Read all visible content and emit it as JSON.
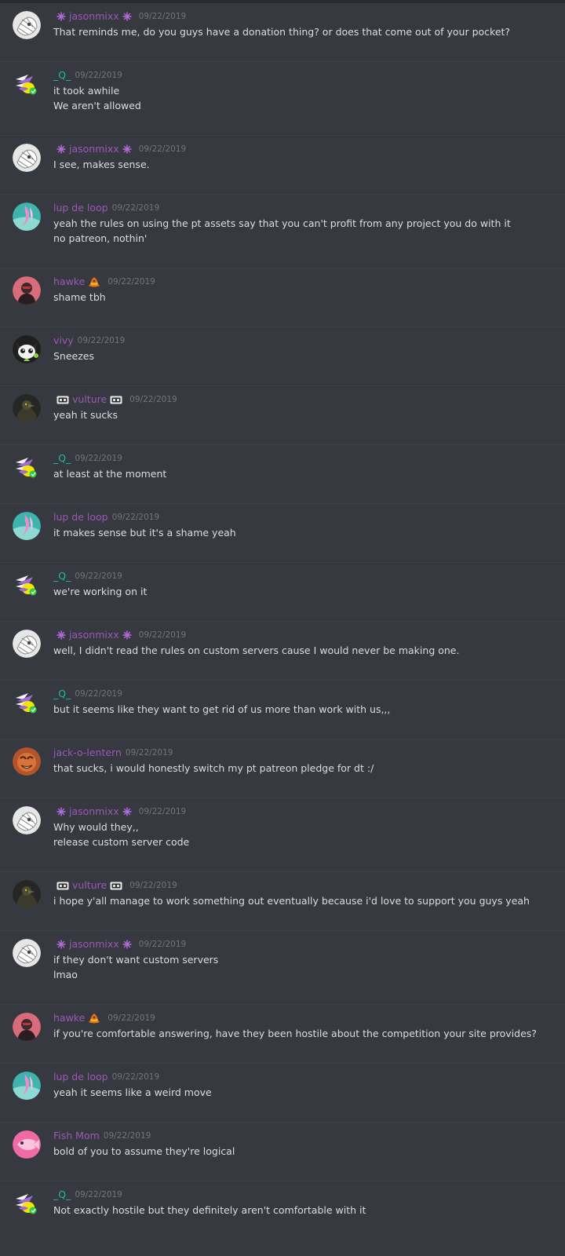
{
  "timestamp": "09/22/2019",
  "colors": {
    "background": "#36393f",
    "divider": "#3f4248",
    "text": "#dcddde",
    "timestamp": "#72767d",
    "purple_role": "#9b59b6",
    "teal_role": "#1abc9c"
  },
  "messages": [
    {
      "author": "jasonmixx",
      "flair": "star",
      "color": "#9b59b6",
      "avatar": "sketch",
      "lines": [
        "That reminds me, do you guys have a donation thing? or does that come out of your pocket?"
      ]
    },
    {
      "author": "_Q_",
      "flair": "none",
      "color": "#1abc9c",
      "avatar": "bird",
      "lines": [
        "it took awhile",
        "We aren't allowed"
      ]
    },
    {
      "author": "jasonmixx",
      "flair": "star",
      "color": "#9b59b6",
      "avatar": "sketch",
      "lines": [
        "I see, makes sense."
      ]
    },
    {
      "author": "lup de loop",
      "flair": "none",
      "color": "#9b59b6",
      "avatar": "lup",
      "lines": [
        "yeah the rules on using the pt assets say that you can't profit from any project you do with it",
        "no patreon, nothin'"
      ]
    },
    {
      "author": "hawke",
      "flair": "hat",
      "color": "#9b59b6",
      "avatar": "hawke",
      "lines": [
        "shame tbh"
      ]
    },
    {
      "author": "vivy",
      "flair": "none",
      "color": "#9b59b6",
      "avatar": "vivy",
      "lines": [
        "Sneezes"
      ]
    },
    {
      "author": "vulture",
      "flair": "tape",
      "color": "#9b59b6",
      "avatar": "vulture",
      "lines": [
        "yeah it sucks"
      ]
    },
    {
      "author": "_Q_",
      "flair": "none",
      "color": "#1abc9c",
      "avatar": "bird",
      "lines": [
        "at least at the moment"
      ]
    },
    {
      "author": "lup de loop",
      "flair": "none",
      "color": "#9b59b6",
      "avatar": "lup",
      "lines": [
        "it makes sense but it's a shame yeah"
      ]
    },
    {
      "author": "_Q_",
      "flair": "none",
      "color": "#1abc9c",
      "avatar": "bird",
      "lines": [
        "we're working on it"
      ]
    },
    {
      "author": "jasonmixx",
      "flair": "star",
      "color": "#9b59b6",
      "avatar": "sketch",
      "lines": [
        "well, I didn't read the rules on custom servers cause I would never be making one."
      ]
    },
    {
      "author": "_Q_",
      "flair": "none",
      "color": "#1abc9c",
      "avatar": "bird",
      "lines": [
        "but it seems like they want to get rid of us more than work with us,,,"
      ]
    },
    {
      "author": "jack-o-lentern",
      "flair": "none",
      "color": "#9b59b6",
      "avatar": "jack",
      "lines": [
        "that sucks, i would honestly switch my pt patreon pledge for dt :/"
      ]
    },
    {
      "author": "jasonmixx",
      "flair": "star",
      "color": "#9b59b6",
      "avatar": "sketch",
      "lines": [
        "Why would they,,",
        "release custom server code"
      ]
    },
    {
      "author": "vulture",
      "flair": "tape",
      "color": "#9b59b6",
      "avatar": "vulture",
      "lines": [
        "i hope y'all manage to work something out eventually because i'd love to support you guys yeah"
      ]
    },
    {
      "author": "jasonmixx",
      "flair": "star",
      "color": "#9b59b6",
      "avatar": "sketch",
      "lines": [
        "if they don't want custom servers",
        "lmao"
      ]
    },
    {
      "author": "hawke",
      "flair": "hat",
      "color": "#9b59b6",
      "avatar": "hawke",
      "lines": [
        "if you're comfortable answering, have they been hostile about the competition your site provides?"
      ]
    },
    {
      "author": "lup de loop",
      "flair": "none",
      "color": "#9b59b6",
      "avatar": "lup",
      "lines": [
        "yeah it seems like a weird move"
      ]
    },
    {
      "author": "Fish Mom",
      "flair": "none",
      "color": "#9b59b6",
      "avatar": "fish",
      "lines": [
        "bold of you to assume they're logical"
      ]
    },
    {
      "author": "_Q_",
      "flair": "none",
      "color": "#1abc9c",
      "avatar": "bird",
      "lines": [
        "Not exactly hostile but they definitely aren't comfortable with it"
      ]
    }
  ]
}
